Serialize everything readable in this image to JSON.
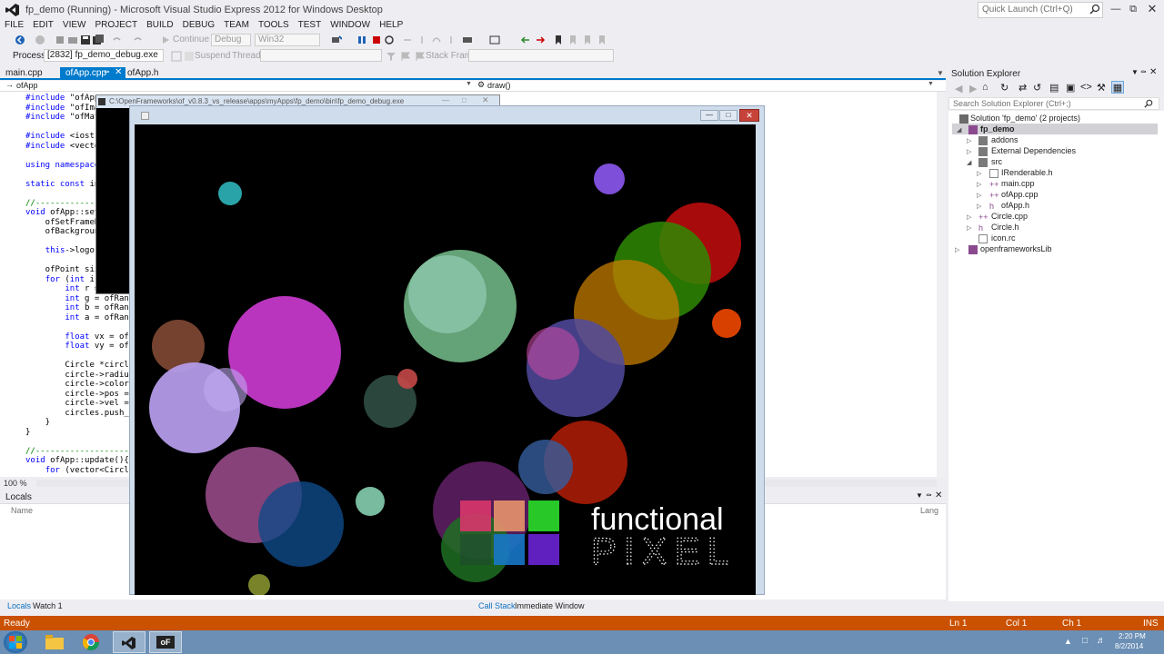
{
  "window": {
    "title": "fp_demo (Running) - Microsoft Visual Studio Express 2012 for Windows Desktop"
  },
  "quick_launch": {
    "placeholder": "Quick Launch (Ctrl+Q)"
  },
  "menu": [
    "FILE",
    "EDIT",
    "VIEW",
    "PROJECT",
    "BUILD",
    "DEBUG",
    "TEAM",
    "TOOLS",
    "TEST",
    "WINDOW",
    "HELP"
  ],
  "toolbar": {
    "continue_label": "Continue",
    "config_value": "Debug",
    "platform_value": "Win32",
    "process_label": "Process:",
    "process_value": "[2832] fp_demo_debug.exe",
    "suspend_label": "Suspend",
    "thread_label": "Thread:",
    "stack_frame_label": "Stack Frame:"
  },
  "doc_tabs": [
    {
      "label": "main.cpp"
    },
    {
      "label": "ofApp.cpp",
      "active": true
    },
    {
      "label": "ofApp.h"
    }
  ],
  "nav": {
    "scope": "ofApp",
    "member": "draw()"
  },
  "code_lines": [
    {
      "html": "<span class='kw'>#include</span> \"ofApp"
    },
    {
      "html": "<span class='kw'>#include</span> \"ofIma"
    },
    {
      "html": "<span class='kw'>#include</span> \"ofMat"
    },
    {
      "html": ""
    },
    {
      "html": "<span class='kw'>#include</span> &lt;iostr"
    },
    {
      "html": "<span class='kw'>#include</span> &lt;vecto"
    },
    {
      "html": ""
    },
    {
      "html": "<span class='kw'>using namespace</span>"
    },
    {
      "html": ""
    },
    {
      "html": "<span class='kw'>static const</span> in"
    },
    {
      "html": ""
    },
    {
      "html": "<span class='cm'>//-------------</span>"
    },
    {
      "html": "<span class='kw'>void</span> ofApp::set"
    },
    {
      "html": "    ofSetFrameR"
    },
    {
      "html": "    ofBackgroun"
    },
    {
      "html": ""
    },
    {
      "html": "    <span class='kw'>this</span>-&gt;logo."
    },
    {
      "html": ""
    },
    {
      "html": "    ofPoint siz"
    },
    {
      "html": "    <span class='kw'>for</span> (<span class='kw'>int</span> i"
    },
    {
      "html": "        <span class='kw'>int</span> r ="
    },
    {
      "html": "        <span class='kw'>int</span> g = ofRandom("
    },
    {
      "html": "        <span class='kw'>int</span> b = ofRandom("
    },
    {
      "html": "        <span class='kw'>int</span> a = ofRandom("
    },
    {
      "html": ""
    },
    {
      "html": "        <span class='kw'>float</span> vx = ofRande"
    },
    {
      "html": "        <span class='kw'>float</span> vy = ofRande"
    },
    {
      "html": ""
    },
    {
      "html": "        Circle *circle ="
    },
    {
      "html": "        circle-&gt;radius ="
    },
    {
      "html": "        circle-&gt;color.set"
    },
    {
      "html": "        circle-&gt;pos = ofV"
    },
    {
      "html": "        circle-&gt;vel = ofV"
    },
    {
      "html": "        circles.push_back"
    },
    {
      "html": "    }"
    },
    {
      "html": "}"
    },
    {
      "html": ""
    },
    {
      "html": "<span class='cm'>//------------------------------</span>"
    },
    {
      "html": "<span class='kw'>void</span> ofApp::update(){"
    },
    {
      "html": "    <span class='kw'>for</span> (vector&lt;Circle*&gt;::"
    }
  ],
  "editor": {
    "zoom": "100 %"
  },
  "locals": {
    "title": "Locals",
    "col_name": "Name",
    "col_lang": "Lang"
  },
  "bottom_tabs": {
    "locals": "Locals",
    "watch": "Watch 1",
    "callstack": "Call Stack",
    "immediate": "Immediate Window"
  },
  "solution_explorer": {
    "title": "Solution Explorer",
    "search_placeholder": "Search Solution Explorer (Ctrl+;)",
    "items": [
      {
        "label": "Solution 'fp_demo' (2 projects)",
        "icon": "solution-icon"
      },
      {
        "label": "fp_demo",
        "icon": "project-icon",
        "bold": true
      },
      {
        "label": "addons",
        "icon": "folder-icon"
      },
      {
        "label": "External Dependencies",
        "icon": "folder-icon"
      },
      {
        "label": "src",
        "icon": "folder-icon"
      },
      {
        "label": "IRenderable.h",
        "icon": "header-file-icon"
      },
      {
        "label": "main.cpp",
        "icon": "cpp-file-icon"
      },
      {
        "label": "ofApp.cpp",
        "icon": "cpp-file-icon"
      },
      {
        "label": "ofApp.h",
        "icon": "header-file-icon"
      },
      {
        "label": "Circle.cpp",
        "icon": "cpp-file-icon"
      },
      {
        "label": "Circle.h",
        "icon": "header-file-icon"
      },
      {
        "label": "icon.rc",
        "icon": "resource-file-icon"
      },
      {
        "label": "openframeworksLib",
        "icon": "project-icon"
      }
    ]
  },
  "status": {
    "ready": "Ready",
    "line": "Ln 1",
    "col": "Col 1",
    "ch": "Ch 1",
    "mode": "INS"
  },
  "console_window": {
    "title": "C:\\OpenFrameworks\\of_v0.8.3_vs_release\\apps\\myApps\\fp_demo\\bin\\fp_demo_debug.exe"
  },
  "logo": {
    "line1": "functional",
    "line2": "PIXEL"
  },
  "taskbar": {
    "time": "2:20 PM",
    "date": "8/2/2014"
  },
  "colors": {
    "accent": "#007acc",
    "status_bar": "#ca5100",
    "taskbar": "#6b8fb5"
  }
}
